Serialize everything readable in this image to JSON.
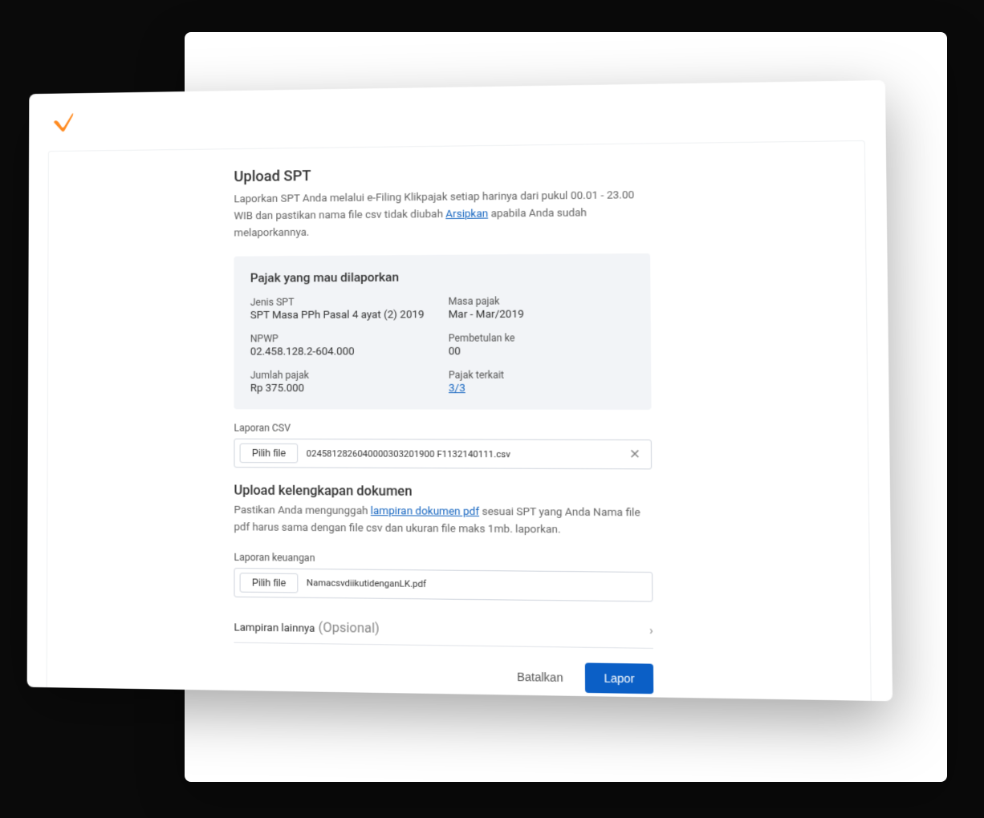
{
  "page": {
    "title": "Upload SPT",
    "subtitle_a": "Laporkan SPT Anda melalui e-Filing Klikpajak setiap harinya dari pukul 00.01 - 23.00 WIB dan pastikan nama file csv tidak diubah",
    "subtitle_link": "Arsipkan",
    "subtitle_b": " apabila Anda sudah melaporkannya."
  },
  "info": {
    "title": "Pajak yang mau dilaporkan",
    "jenis_label": "Jenis SPT",
    "jenis_value": "SPT Masa PPh Pasal 4 ayat (2) 2019",
    "masa_label": "Masa pajak",
    "masa_value": "Mar - Mar/2019",
    "npwp_label": "NPWP",
    "npwp_value": "02.458.128.2-604.000",
    "pembetulan_label": "Pembetulan ke",
    "pembetulan_value": "00",
    "jumlah_label": "Jumlah pajak",
    "jumlah_value": "Rp 375.000",
    "terkait_label": "Pajak terkait",
    "terkait_value": "3/3"
  },
  "csv": {
    "label": "Laporan CSV",
    "pick": "Pilih file",
    "filename": "0245812826040000303201900 F1132140111.csv"
  },
  "docs": {
    "title": "Upload kelengkapan dokumen",
    "desc_a": "Pastikan Anda mengunggah ",
    "desc_link": "lampiran dokumen pdf",
    "desc_b": " sesuai SPT yang Anda Nama file pdf harus sama dengan file csv dan ukuran file maks 1mb. laporkan."
  },
  "lk": {
    "label": "Laporan keuangan",
    "pick": "Pilih file",
    "filename": "NamacsvdiikutidenganLK.pdf"
  },
  "lampiran": {
    "label": "Lampiran lainnya",
    "optional": "(Opsional)"
  },
  "actions": {
    "cancel": "Batalkan",
    "submit": "Lapor"
  }
}
